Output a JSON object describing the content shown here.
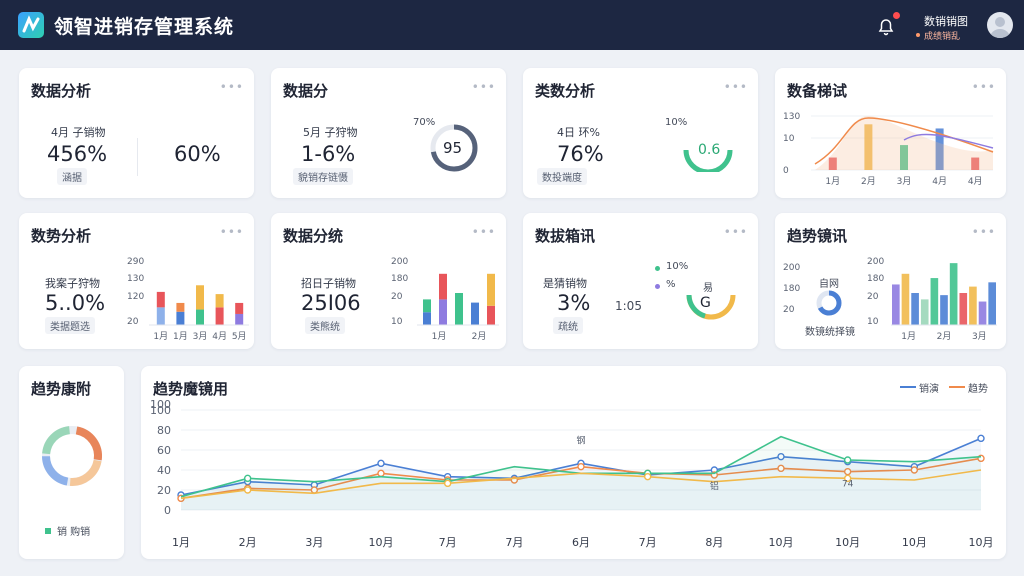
{
  "app": {
    "title": "领智进销存管理系统",
    "user_name": "数销销图",
    "user_sub": "成绩销乱"
  },
  "colors": {
    "header": "#1d2742",
    "blue": "#4a7fd4",
    "orange": "#f08a4b",
    "green": "#3fc28d",
    "yellow": "#f1b94a",
    "red": "#e8555a"
  },
  "cards": {
    "c1": {
      "title": "数据分析",
      "label": "4月 子销物",
      "value": "456%",
      "value2": "60%",
      "badge": "涵据",
      "more": "•••"
    },
    "c2": {
      "title": "数据分",
      "label": "5月 子狩物",
      "value": "1-6%",
      "badge": "貌销存链慑",
      "more": "•••",
      "gauge_top": "70%",
      "gauge_value": "95"
    },
    "c3": {
      "title": "类数分析",
      "label": "4日 环%",
      "value": "76%",
      "badge": "数投端度",
      "more": "•••",
      "gauge_top": "10%",
      "gauge_value": "0.6"
    },
    "c4": {
      "title": "数备梯试",
      "more": "•••"
    },
    "c5": {
      "title": "数势分析",
      "label": "我案子狩物",
      "value": "5..0%",
      "badge": "类据题选",
      "more": "•••"
    },
    "c6": {
      "title": "数据分统",
      "label": "招日子销物",
      "value": "25I06",
      "badge": "类熊统",
      "more": "•••"
    },
    "c7": {
      "title": "数拔箱讯",
      "label": "是猜销物",
      "value": "3%",
      "value2": "1:05",
      "badge": "疏统",
      "more": "•••",
      "legend": [
        "10%",
        "%"
      ],
      "gauge_label": "易",
      "gauge_value": "G"
    },
    "c8": {
      "title": "趋势镜讯",
      "more": "•••",
      "donut_label": "自网",
      "caption": "数镜统择镜"
    },
    "c9": {
      "title": "趋势康附",
      "legend": "销 购销"
    },
    "c10": {
      "title": "趋势魔镜用",
      "legend": [
        "销演",
        "趋势"
      ]
    }
  },
  "chart_data": [
    {
      "type": "bar",
      "title": "数备梯试",
      "yticks": [
        "130",
        "10",
        "0"
      ],
      "categories": [
        "1月",
        "2月",
        "3月",
        "4月",
        "4月"
      ],
      "ylim": [
        0,
        130
      ],
      "series": [
        {
          "values": [
            30,
            0,
            0,
            0,
            0
          ]
        },
        {
          "values": [
            0,
            110,
            0,
            0,
            0
          ]
        },
        {
          "values": [
            0,
            0,
            60,
            0,
            0
          ]
        },
        {
          "values": [
            0,
            0,
            0,
            100,
            0
          ]
        },
        {
          "values": [
            0,
            0,
            0,
            0,
            30
          ]
        }
      ]
    },
    {
      "type": "bar",
      "title": "数势分析",
      "yticks": [
        "290",
        "130",
        "120",
        "20"
      ],
      "categories": [
        "1月",
        "1月",
        "3月",
        "4月",
        "5月"
      ],
      "ylim": [
        0,
        290
      ],
      "stacked": [
        [
          80,
          70
        ],
        [
          60,
          40
        ],
        [
          70,
          110
        ],
        [
          80,
          60
        ],
        [
          50,
          50
        ]
      ]
    },
    {
      "type": "bar",
      "title": "数据分统",
      "yticks": [
        "200",
        "180",
        "20",
        "10"
      ],
      "categories": [
        "1月",
        "2月"
      ],
      "ylim": [
        0,
        200
      ],
      "stacked": [
        [
          40,
          40
        ],
        [
          80,
          80
        ],
        [
          100,
          0
        ],
        [
          70,
          0
        ],
        [
          60,
          100
        ]
      ]
    },
    {
      "type": "bar",
      "title": "趋势镜讯",
      "yticks": [
        "200",
        "180",
        "20",
        "10"
      ],
      "categories": [
        "1月",
        "2月",
        "3月"
      ],
      "ylim": [
        0,
        200
      ],
      "series": [
        {
          "values": [
            90,
            0,
            70,
            0,
            120,
            0,
            0
          ]
        }
      ]
    },
    {
      "type": "line",
      "title": "趋势魔镜用",
      "categories": [
        "1月",
        "2月",
        "3月",
        "10月",
        "7月",
        "7月",
        "6月",
        "7月",
        "8月",
        "10月",
        "10月",
        "10月",
        "10月"
      ],
      "yticks": [
        "100",
        "100",
        "80",
        "60",
        "40",
        "20",
        "0"
      ],
      "ylim": [
        0,
        120
      ],
      "series": [
        {
          "name": "销演",
          "color": "#4a7fd4",
          "values": [
            18,
            34,
            30,
            56,
            40,
            38,
            56,
            42,
            48,
            64,
            58,
            52,
            86
          ]
        },
        {
          "name": "趋势",
          "color": "#f08a4b",
          "values": [
            14,
            26,
            24,
            44,
            36,
            36,
            52,
            44,
            42,
            50,
            46,
            48,
            62
          ]
        },
        {
          "name": "",
          "color": "#3fc28d",
          "values": [
            16,
            38,
            34,
            40,
            34,
            52,
            44,
            44,
            44,
            88,
            60,
            58,
            64
          ]
        },
        {
          "name": "",
          "color": "#f1b94a",
          "values": [
            14,
            24,
            20,
            32,
            32,
            38,
            44,
            40,
            34,
            40,
            38,
            36,
            48
          ]
        }
      ],
      "annotations": [
        "钢",
        "铝",
        "74"
      ]
    }
  ]
}
